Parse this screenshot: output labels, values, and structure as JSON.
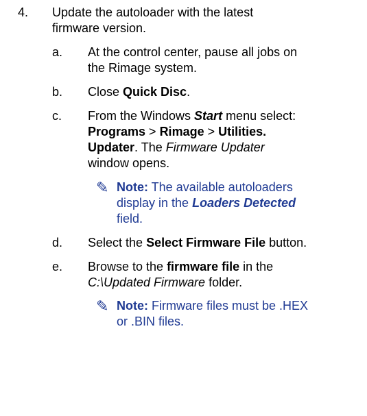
{
  "step4": {
    "number": "4.",
    "line1": "Update the autoloader with the latest",
    "line2": "firmware version."
  },
  "sub_a": {
    "letter": "a.",
    "line1": "At the control center, pause all jobs on",
    "line2": "the Rimage system."
  },
  "sub_b": {
    "letter": "b.",
    "prefix": "Close ",
    "bold": "Quick Disc",
    "suffix": "."
  },
  "sub_c": {
    "letter": "c.",
    "l1_prefix": "From the Windows ",
    "l1_start": "Start",
    "l1_suffix": " menu select:",
    "l2_programs": "Programs",
    "l2_sep1": " > ",
    "l2_rimage": "Rimage",
    "l2_sep2": " > ",
    "l2_utilities": "Utilities",
    "l2_end": ".",
    "l3_updater": "Updater",
    "l3_text": ". The ",
    "l3_firmware_updater": "Firmware Updater",
    "l4": "window opens."
  },
  "note1": {
    "icon": "pencil-icon",
    "label": "Note:",
    "l1_rest": " The available autoloaders",
    "l2_prefix": "display in the ",
    "l2_bold": "Loaders Detected",
    "l3": "field."
  },
  "sub_d": {
    "letter": "d.",
    "prefix": "Select the ",
    "bold": "Select Firmware File",
    "suffix": " button."
  },
  "sub_e": {
    "letter": "e.",
    "l1_prefix": "Browse to the ",
    "l1_bold": "firmware file",
    "l1_suffix": " in the",
    "l2_italic": "C:\\Updated Firmware",
    "l2_suffix": " folder."
  },
  "note2": {
    "icon": "pencil-icon",
    "label": "Note:",
    "l1_rest": " Firmware files must be .HEX",
    "l2": "or .BIN files."
  }
}
